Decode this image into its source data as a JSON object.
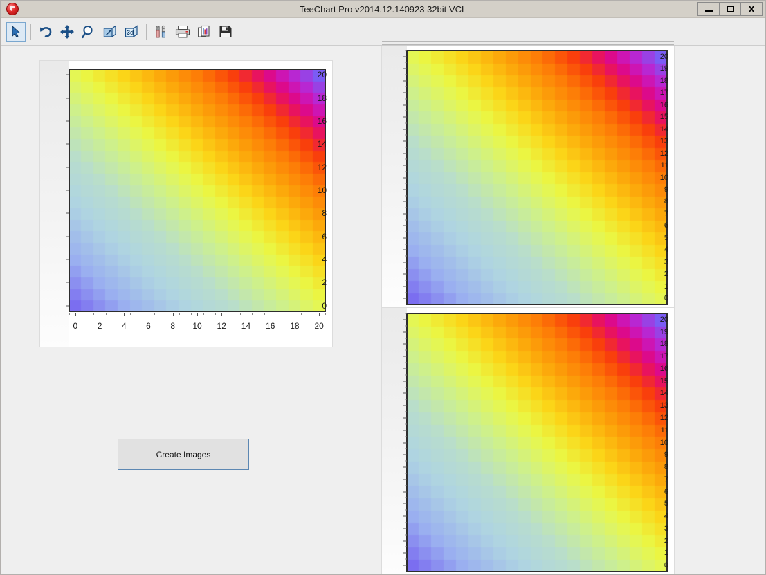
{
  "window": {
    "title": "TeeChart Pro v2014.12.140923 32bit VCL",
    "app_icon": "teechart-globe-icon",
    "controls": {
      "minimize": "minimize-icon",
      "maximize": "maximize-icon",
      "close": "X"
    },
    "frame_color": "#b3b0ad",
    "titlebar_color": "#d4d0c8",
    "client_color": "#efefef"
  },
  "toolbar": {
    "items": [
      {
        "name": "select-tool-button",
        "icon": "cursor-arrow-icon",
        "active": true
      },
      {
        "name": "undo-button",
        "icon": "undo-arrow-icon",
        "active": false
      },
      {
        "name": "pan-button",
        "icon": "move-cross-icon",
        "active": false
      },
      {
        "name": "zoom-button",
        "icon": "magnifier-icon",
        "active": false
      },
      {
        "name": "normal-view-button",
        "icon": "cube-2d-icon",
        "active": false
      },
      {
        "name": "three-d-button",
        "icon": "cube-3d-icon",
        "active": false
      },
      {
        "name": "edit-chart-button",
        "icon": "tools-wrench-icon",
        "active": false
      },
      {
        "name": "print-button",
        "icon": "printer-icon",
        "active": false
      },
      {
        "name": "copy-button",
        "icon": "copy-pages-icon",
        "active": false
      },
      {
        "name": "save-button",
        "icon": "floppy-disk-icon",
        "active": false
      }
    ],
    "separator_after": [
      0,
      5
    ]
  },
  "main": {
    "create_images_button": "Create Images"
  },
  "chart_data": [
    {
      "id": "chart-main",
      "type": "heatmap",
      "title": "",
      "xlabel": "",
      "ylabel": "",
      "xlim": [
        0,
        21
      ],
      "ylim": [
        0,
        21
      ],
      "grid": false,
      "legend": "none",
      "cols": 21,
      "rows": 21,
      "x_ticks": [
        0,
        2,
        4,
        6,
        8,
        10,
        12,
        14,
        16,
        18,
        20
      ],
      "y_ticks": [
        0,
        2,
        4,
        6,
        8,
        10,
        12,
        14,
        16,
        18,
        20
      ],
      "show_x_axis_labels": true,
      "show_y_axis_labels": true,
      "value_formula": "v = (col + row) / 40",
      "palette": "rainbow-blue-to-magenta",
      "palette_stops": [
        {
          "t": 0.0,
          "color": "#7b6ef0"
        },
        {
          "t": 0.1,
          "color": "#9aaff0"
        },
        {
          "t": 0.22,
          "color": "#aed4e2"
        },
        {
          "t": 0.32,
          "color": "#b8ddcd"
        },
        {
          "t": 0.42,
          "color": "#ccf08f"
        },
        {
          "t": 0.52,
          "color": "#eaf745"
        },
        {
          "t": 0.6,
          "color": "#fbd518"
        },
        {
          "t": 0.68,
          "color": "#fca60a"
        },
        {
          "t": 0.76,
          "color": "#fd7806"
        },
        {
          "t": 0.83,
          "color": "#f93b0c"
        },
        {
          "t": 0.89,
          "color": "#e2067b"
        },
        {
          "t": 0.94,
          "color": "#c41ccb"
        },
        {
          "t": 1.0,
          "color": "#7b5cf5"
        }
      ]
    },
    {
      "id": "chart-top",
      "type": "heatmap",
      "title": "",
      "xlabel": "",
      "ylabel": "",
      "xlim": [
        0,
        21
      ],
      "ylim": [
        0,
        21
      ],
      "grid": false,
      "legend": "none",
      "cols": 21,
      "rows": 21,
      "x_ticks": [],
      "y_ticks": [
        0,
        1,
        2,
        3,
        4,
        5,
        6,
        7,
        8,
        9,
        10,
        11,
        12,
        13,
        14,
        15,
        16,
        17,
        18,
        19,
        20
      ],
      "show_x_axis_labels": false,
      "show_y_axis_labels": true,
      "value_formula": "v = (col + row) / 40",
      "palette": "rainbow-blue-to-magenta"
    },
    {
      "id": "chart-bot",
      "type": "heatmap",
      "title": "",
      "xlabel": "",
      "ylabel": "",
      "xlim": [
        0,
        21
      ],
      "ylim": [
        0,
        21
      ],
      "grid": false,
      "legend": "none",
      "cols": 21,
      "rows": 21,
      "x_ticks": [],
      "y_ticks": [
        0,
        1,
        2,
        3,
        4,
        5,
        6,
        7,
        8,
        9,
        10,
        11,
        12,
        13,
        14,
        15,
        16,
        17,
        18,
        19,
        20
      ],
      "show_x_axis_labels": false,
      "show_y_axis_labels": true,
      "value_formula": "v = (col + row) / 40",
      "palette": "rainbow-blue-to-magenta"
    }
  ]
}
